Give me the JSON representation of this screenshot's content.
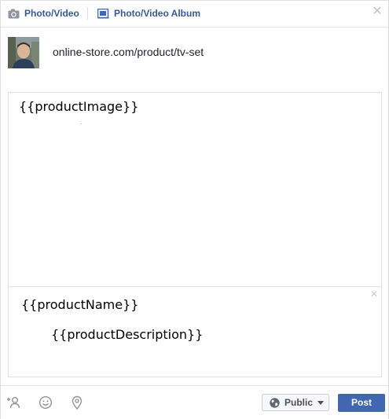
{
  "tabs": {
    "photo_video": "Photo/Video",
    "photo_video_album": "Photo/Video Album"
  },
  "icons": {
    "close": "close-icon",
    "camera": "camera-icon",
    "album": "album-icon",
    "tag_people": "tag-people-icon",
    "feeling": "feeling-icon",
    "location": "location-icon",
    "globe": "globe-icon",
    "caret": "chevron-down-icon"
  },
  "post": {
    "link": "online-store.com/product/tv-set"
  },
  "preview": {
    "image_placeholder": "{{productImage}}",
    "name_placeholder": "{{productName}}",
    "description_placeholder": "{{productDescription}}"
  },
  "footer": {
    "audience_label": "Public",
    "post_label": "Post"
  },
  "colors": {
    "tab_label": "#365899",
    "post_button": "#4267b2",
    "border": "#dddfe2"
  }
}
